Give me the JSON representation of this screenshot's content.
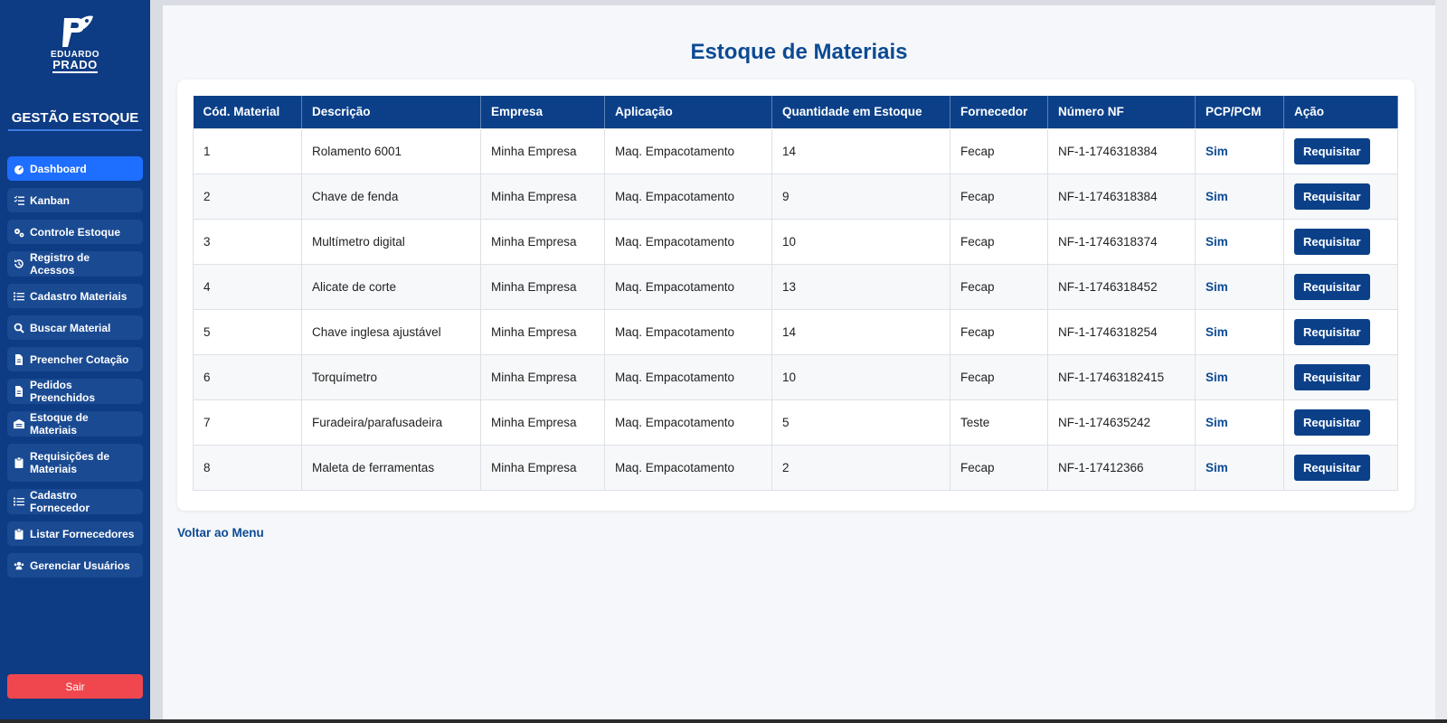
{
  "sidebar": {
    "logo_top": "EDUARDO",
    "logo_bottom": "PRADO",
    "title": "GESTÃO ESTOQUE",
    "items": [
      {
        "label": "Dashboard",
        "icon": "gauge-icon"
      },
      {
        "label": "Kanban",
        "icon": "list-check-icon"
      },
      {
        "label": "Controle Estoque",
        "icon": "gears-icon"
      },
      {
        "label": "Registro de Acessos",
        "icon": "history-icon"
      },
      {
        "label": "Cadastro Materiais",
        "icon": "list-icon"
      },
      {
        "label": "Buscar Material",
        "icon": "search-icon"
      },
      {
        "label": "Preencher Cotação",
        "icon": "file-icon"
      },
      {
        "label": "Pedidos Preenchidos",
        "icon": "file-icon"
      },
      {
        "label": "Estoque de Materiais",
        "icon": "warehouse-icon"
      },
      {
        "label": "Requisições de Materiais",
        "icon": "clipboard-icon"
      },
      {
        "label": "Cadastro Fornecedor",
        "icon": "list-icon"
      },
      {
        "label": "Listar Fornecedores",
        "icon": "clipboard-icon"
      },
      {
        "label": "Gerenciar Usuários",
        "icon": "users-icon"
      }
    ],
    "logout_label": "Sair"
  },
  "main": {
    "title": "Estoque de Materiais",
    "back_link": "Voltar ao Menu",
    "table": {
      "headers": [
        "Cód. Material",
        "Descrição",
        "Empresa",
        "Aplicação",
        "Quantidade em Estoque",
        "Fornecedor",
        "Número NF",
        "PCP/PCM",
        "Ação"
      ],
      "rows": [
        {
          "cod": "1",
          "descricao": "Rolamento 6001",
          "empresa": "Minha Empresa",
          "aplicacao": "Maq. Empacotamento",
          "quantidade": "14",
          "fornecedor": "Fecap",
          "nf": "NF-1-1746318384",
          "pcp": "Sim",
          "acao": "Requisitar"
        },
        {
          "cod": "2",
          "descricao": "Chave de fenda",
          "empresa": "Minha Empresa",
          "aplicacao": "Maq. Empacotamento",
          "quantidade": "9",
          "fornecedor": "Fecap",
          "nf": "NF-1-1746318384",
          "pcp": "Sim",
          "acao": "Requisitar"
        },
        {
          "cod": "3",
          "descricao": "Multímetro digital",
          "empresa": "Minha Empresa",
          "aplicacao": "Maq. Empacotamento",
          "quantidade": "10",
          "fornecedor": "Fecap",
          "nf": "NF-1-1746318374",
          "pcp": "Sim",
          "acao": "Requisitar"
        },
        {
          "cod": "4",
          "descricao": "Alicate de corte",
          "empresa": "Minha Empresa",
          "aplicacao": "Maq. Empacotamento",
          "quantidade": "13",
          "fornecedor": "Fecap",
          "nf": "NF-1-1746318452",
          "pcp": "Sim",
          "acao": "Requisitar"
        },
        {
          "cod": "5",
          "descricao": "Chave inglesa ajustável",
          "empresa": "Minha Empresa",
          "aplicacao": "Maq. Empacotamento",
          "quantidade": "14",
          "fornecedor": "Fecap",
          "nf": "NF-1-1746318254",
          "pcp": "Sim",
          "acao": "Requisitar"
        },
        {
          "cod": "6",
          "descricao": "Torquímetro",
          "empresa": "Minha Empresa",
          "aplicacao": "Maq. Empacotamento",
          "quantidade": "10",
          "fornecedor": "Fecap",
          "nf": "NF-1-17463182415",
          "pcp": "Sim",
          "acao": "Requisitar"
        },
        {
          "cod": "7",
          "descricao": "Furadeira/parafusadeira",
          "empresa": "Minha Empresa",
          "aplicacao": "Maq. Empacotamento",
          "quantidade": "5",
          "fornecedor": "Teste",
          "nf": "NF-1-174635242",
          "pcp": "Sim",
          "acao": "Requisitar"
        },
        {
          "cod": "8",
          "descricao": "Maleta de ferramentas",
          "empresa": "Minha Empresa",
          "aplicacao": "Maq. Empacotamento",
          "quantidade": "2",
          "fornecedor": "Fecap",
          "nf": "NF-1-17412366",
          "pcp": "Sim",
          "acao": "Requisitar"
        }
      ]
    }
  },
  "colors": {
    "sidebar_bg": "#0d3b84",
    "active_item": "#1e6fff",
    "table_header": "#0b4089",
    "logout": "#f0474f",
    "title": "#0d4a94"
  }
}
